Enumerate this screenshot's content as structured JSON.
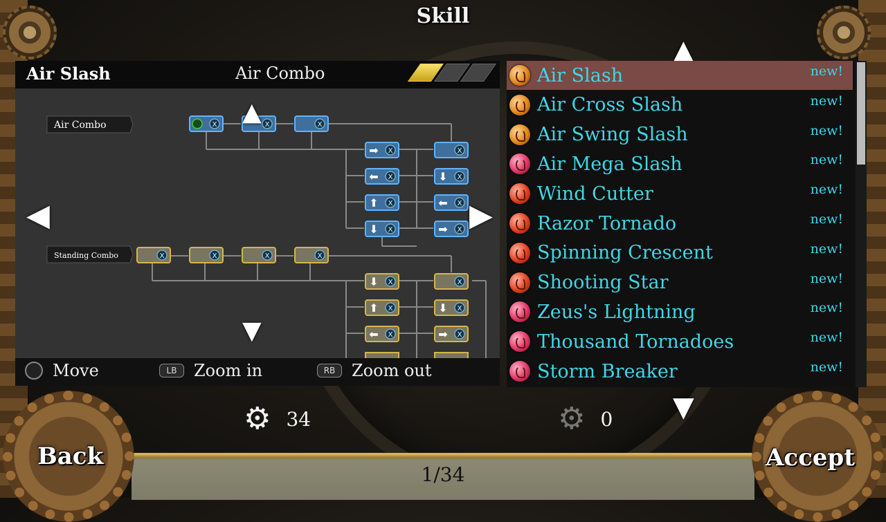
{
  "screen_title": "Skill",
  "detail": {
    "skill_name": "Air Slash",
    "combo_type": "Air Combo",
    "level_filled": 1,
    "level_total": 3,
    "tree_labels": {
      "air_combo": "Air Combo",
      "standing_combo": "Standing Combo"
    },
    "controls": [
      {
        "icon": "L",
        "label": "Move"
      },
      {
        "icon": "LB",
        "label": "Zoom in"
      },
      {
        "icon": "RB",
        "label": "Zoom out"
      }
    ]
  },
  "skills": [
    {
      "name": "Air Slash",
      "badge": "new!",
      "orb": "orange",
      "selected": true
    },
    {
      "name": "Air Cross Slash",
      "badge": "new!",
      "orb": "orange",
      "selected": false
    },
    {
      "name": "Air Swing Slash",
      "badge": "new!",
      "orb": "orange",
      "selected": false
    },
    {
      "name": "Air Mega Slash",
      "badge": "new!",
      "orb": "pink",
      "selected": false
    },
    {
      "name": "Wind Cutter",
      "badge": "new!",
      "orb": "red",
      "selected": false
    },
    {
      "name": "Razor Tornado",
      "badge": "new!",
      "orb": "red",
      "selected": false
    },
    {
      "name": "Spinning Crescent",
      "badge": "new!",
      "orb": "red",
      "selected": false
    },
    {
      "name": "Shooting Star",
      "badge": "new!",
      "orb": "red",
      "selected": false
    },
    {
      "name": "Zeus's Lightning",
      "badge": "new!",
      "orb": "pink",
      "selected": false
    },
    {
      "name": "Thousand Tornadoes",
      "badge": "new!",
      "orb": "pink",
      "selected": false
    },
    {
      "name": "Storm Breaker",
      "badge": "new!",
      "orb": "pink",
      "selected": false
    }
  ],
  "points": {
    "available": "34",
    "cost": "0"
  },
  "pager": "1/34",
  "buttons": {
    "back": "Back",
    "accept": "Accept"
  },
  "colors": {
    "list_text": "#3fd6e6",
    "selected_row": "#7a4a45",
    "level_on": "#f3d64b"
  }
}
